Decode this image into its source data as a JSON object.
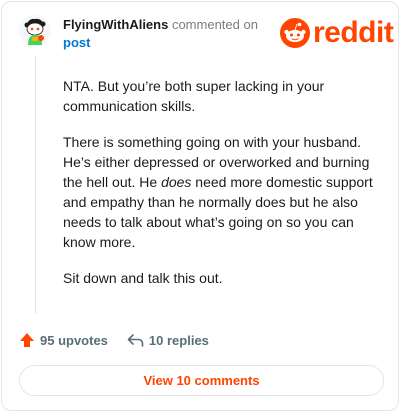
{
  "header": {
    "username": "FlyingWithAliens",
    "action_text": "commented on",
    "post_link": "post",
    "logo_text": "reddit"
  },
  "comment": {
    "paragraph1": "NTA. But you’re both super lacking in your communication skills.",
    "paragraph2_before": "There is something going on with your husband. He’s either depressed or overworked and burning the hell out. He ",
    "paragraph2_emphasis": "does",
    "paragraph2_after": " need more domestic support and empathy than he normally does but he also needs to talk about what’s going on so you can know more.",
    "paragraph3": "Sit down and talk this out."
  },
  "actions": {
    "upvotes": "95 upvotes",
    "replies": "10 replies"
  },
  "view_comments_label": "View 10 comments",
  "colors": {
    "brand": "#ff4500",
    "link": "#0079d3",
    "text": "#1c1c1c",
    "muted": "#576f76"
  },
  "icons": {
    "avatar": "snoo-avatar-icon",
    "logo": "reddit-snoo-icon",
    "upvote": "upvote-arrow-icon",
    "reply": "reply-arrow-icon"
  }
}
